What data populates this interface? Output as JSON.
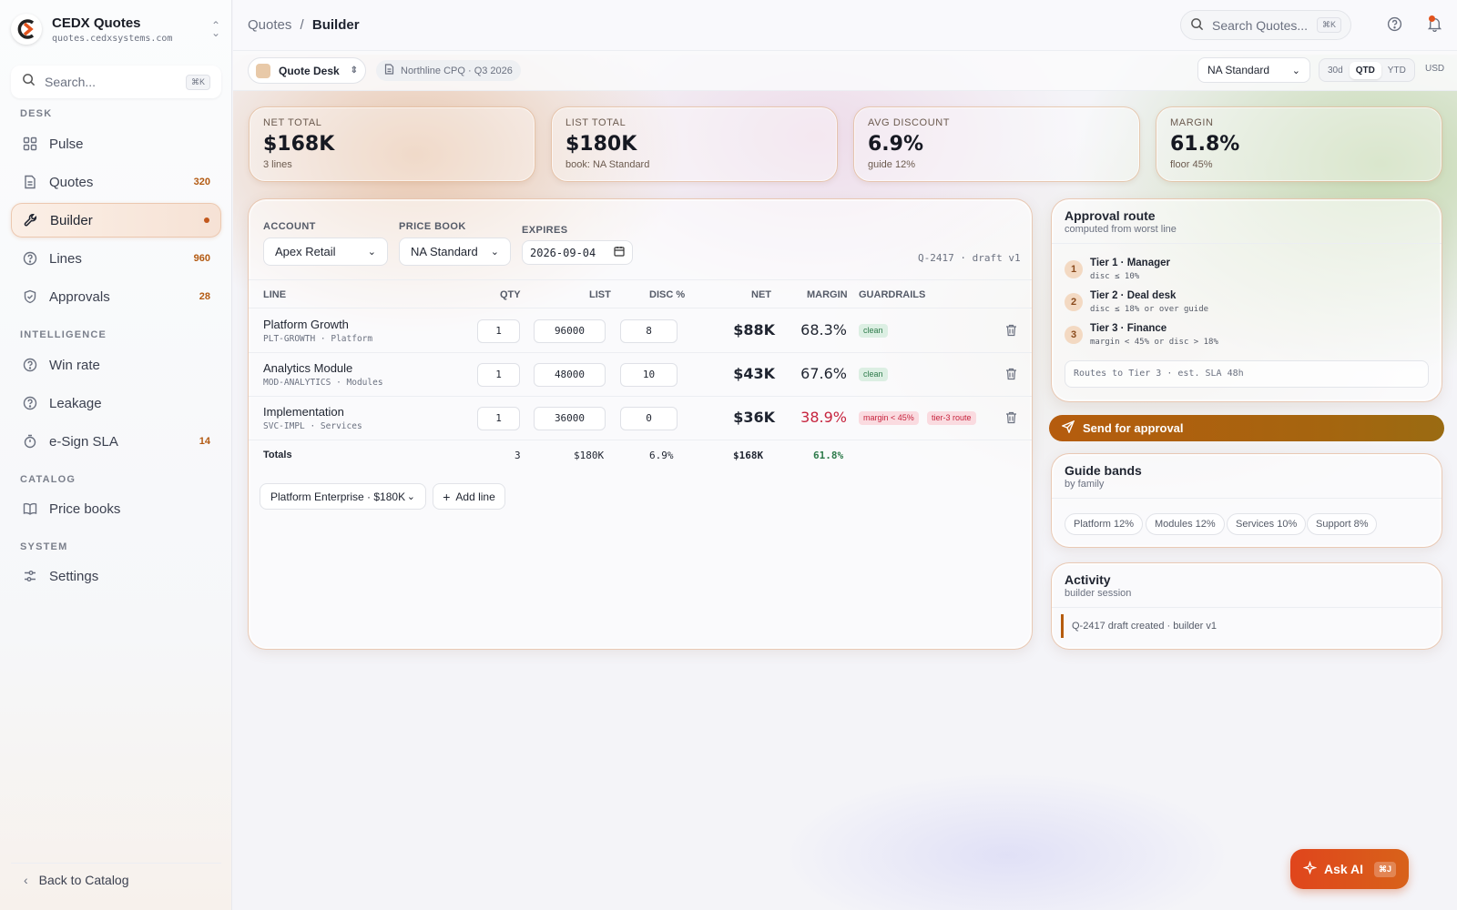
{
  "app": {
    "name": "CEDX Quotes",
    "url": "quotes.cedxsystems.com"
  },
  "sidebar": {
    "search_placeholder": "Search...",
    "search_kbd": "⌘K",
    "sections": {
      "desk": "DESK",
      "intelligence": "INTELLIGENCE",
      "catalog": "CATALOG",
      "system": "SYSTEM"
    },
    "items": [
      {
        "label": "Pulse",
        "icon": "grid-icon"
      },
      {
        "label": "Quotes",
        "icon": "document-icon",
        "count": "320"
      },
      {
        "label": "Builder",
        "icon": "wrench-icon",
        "active": true
      },
      {
        "label": "Lines",
        "icon": "help-circle-icon",
        "count": "960"
      },
      {
        "label": "Approvals",
        "icon": "shield-check-icon",
        "count": "28"
      },
      {
        "label": "Win rate",
        "icon": "help-circle-icon"
      },
      {
        "label": "Leakage",
        "icon": "help-circle-icon"
      },
      {
        "label": "e-Sign SLA",
        "icon": "timer-icon",
        "count": "14"
      },
      {
        "label": "Price books",
        "icon": "book-icon"
      },
      {
        "label": "Settings",
        "icon": "sliders-icon"
      }
    ],
    "back_label": "Back to Catalog"
  },
  "topbar": {
    "breadcrumb_root": "Quotes",
    "breadcrumb_sep": "/",
    "breadcrumb_current": "Builder",
    "search_placeholder": "Search Quotes...",
    "search_kbd": "⌘K"
  },
  "subbar": {
    "desk_label": "Quote Desk",
    "file_label": "Northline CPQ · Q3 2026",
    "price_book": "NA Standard",
    "ranges": [
      "30d",
      "QTD",
      "YTD"
    ],
    "active_range": "QTD",
    "currency": "USD"
  },
  "kpis": [
    {
      "label": "NET TOTAL",
      "value": "$168K",
      "sub": "3 lines"
    },
    {
      "label": "LIST TOTAL",
      "value": "$180K",
      "sub": "book: NA Standard"
    },
    {
      "label": "AVG DISCOUNT",
      "value": "6.9%",
      "sub": "guide 12%"
    },
    {
      "label": "MARGIN",
      "value": "61.8%",
      "sub": "floor 45%"
    }
  ],
  "builder": {
    "account_label": "ACCOUNT",
    "account_value": "Apex Retail",
    "pricebook_label": "PRICE BOOK",
    "pricebook_value": "NA Standard",
    "expires_label": "EXPIRES",
    "expires_value": "2026-09-04",
    "draft": "Q-2417 · draft v1",
    "columns": {
      "line": "LINE",
      "qty": "QTY",
      "list": "LIST",
      "disc": "DISC %",
      "net": "NET",
      "margin": "MARGIN",
      "guardrails": "GUARDRAILS"
    },
    "rows": [
      {
        "name": "Platform Growth",
        "sku": "PLT-GROWTH · Platform",
        "qty": "1",
        "list": "96000",
        "disc": "8",
        "net": "$88K",
        "margin": "68.3%",
        "badges": [
          "clean"
        ]
      },
      {
        "name": "Analytics Module",
        "sku": "MOD-ANALYTICS · Modules",
        "qty": "1",
        "list": "48000",
        "disc": "10",
        "net": "$43K",
        "margin": "67.6%",
        "badges": [
          "clean"
        ]
      },
      {
        "name": "Implementation",
        "sku": "SVC-IMPL · Services",
        "qty": "1",
        "list": "36000",
        "disc": "0",
        "net": "$36K",
        "margin": "38.9%",
        "badges": [
          "margin < 45%",
          "tier-3 route"
        ]
      }
    ],
    "totals": {
      "label": "Totals",
      "qty": "3",
      "list": "$180K",
      "disc": "6.9%",
      "net": "$168K",
      "margin": "61.8%"
    },
    "add_select": "Platform Enterprise · $180K",
    "add_button": "Add line"
  },
  "approval": {
    "title": "Approval route",
    "subtitle": "computed from worst line",
    "tiers": [
      {
        "n": "1",
        "name": "Tier 1 · Manager",
        "rule": "disc ≤ 10%"
      },
      {
        "n": "2",
        "name": "Tier 2 · Deal desk",
        "rule": "disc ≤ 18% or over guide"
      },
      {
        "n": "3",
        "name": "Tier 3 · Finance",
        "rule": "margin < 45% or disc > 18%"
      }
    ],
    "routes": "Routes to Tier 3 · est. SLA 48h",
    "send_label": "Send for approval"
  },
  "guide": {
    "title": "Guide bands",
    "subtitle": "by family",
    "chips": [
      "Platform 12%",
      "Modules 12%",
      "Services 10%",
      "Support 8%"
    ]
  },
  "activity": {
    "title": "Activity",
    "subtitle": "builder session",
    "items": [
      "Q-2417 draft created · builder v1"
    ]
  },
  "ask_ai": {
    "label": "Ask AI",
    "kbd": "⌘J"
  },
  "colors": {
    "accent": "#b55c0e",
    "danger": "#c6243e",
    "success": "#2d7a4a"
  }
}
